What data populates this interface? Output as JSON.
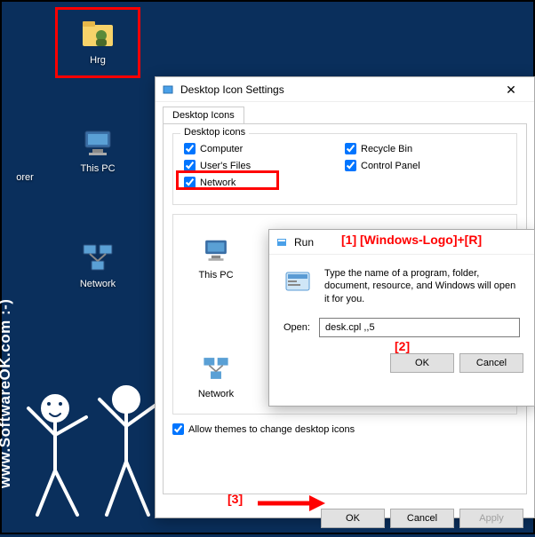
{
  "desktop": {
    "icons": {
      "hrg": "Hrg",
      "explorer": "orer",
      "thispc": "This PC",
      "network": "Network"
    }
  },
  "watermark": "www.SoftwareOK.com :-)",
  "side_text": "w",
  "settings": {
    "title": "Desktop Icon Settings",
    "tab": "Desktop Icons",
    "group_legend": "Desktop icons",
    "checks": {
      "computer": "Computer",
      "recycle": "Recycle Bin",
      "userfiles": "User's Files",
      "control": "Control Panel",
      "network": "Network"
    },
    "icon_cells": {
      "thispc": "This PC",
      "network": "Network"
    },
    "allow_themes": "Allow themes to change desktop icons",
    "buttons": {
      "ok": "OK",
      "cancel": "Cancel",
      "apply": "Apply"
    }
  },
  "run": {
    "title": "Run",
    "desc": "Type the name of a program, folder, document, resource, and Windows will open it for you.",
    "open_label": "Open:",
    "open_value": "desk.cpl ,,5",
    "buttons": {
      "ok": "OK",
      "cancel": "Cancel"
    }
  },
  "annotations": {
    "a1": "[1]  [Windows-Logo]+[R]",
    "a2": "[2]",
    "a3": "[3]"
  }
}
